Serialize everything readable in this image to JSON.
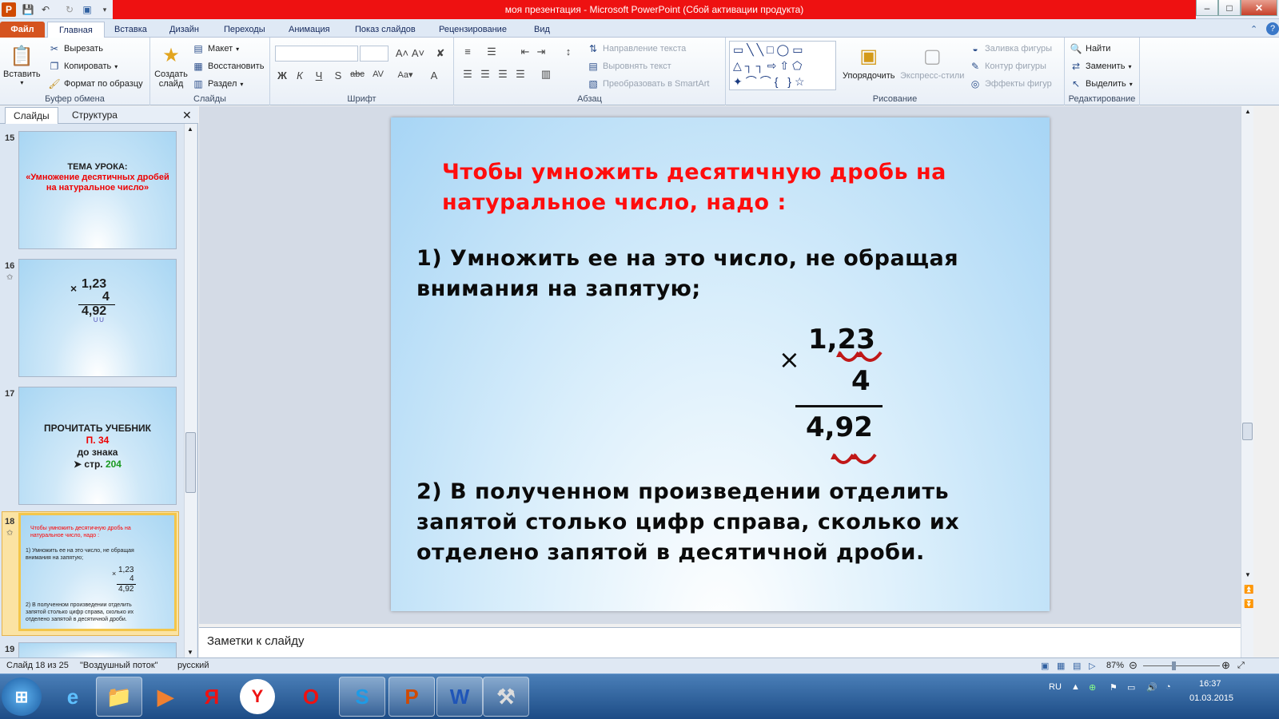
{
  "titlebar": {
    "title": "моя презентация  -  Microsoft PowerPoint (Сбой активации продукта)",
    "app_icon": "P"
  },
  "ribbon_tabs": [
    "Файл",
    "Главная",
    "Вставка",
    "Дизайн",
    "Переходы",
    "Анимация",
    "Показ слайдов",
    "Рецензирование",
    "Вид"
  ],
  "clipboard": {
    "paste": "Вставить",
    "cut": "Вырезать",
    "copy": "Копировать",
    "format_painter": "Формат по образцу",
    "label": "Буфер обмена"
  },
  "slides_group": {
    "new_slide": "Создать слайд",
    "layout": "Макет",
    "reset": "Восстановить",
    "section": "Раздел",
    "label": "Слайды"
  },
  "font_group": {
    "label": "Шрифт",
    "bold": "Ж",
    "italic": "К",
    "underline": "Ч",
    "shadow": "S",
    "strike": "abc"
  },
  "paragraph_group": {
    "text_direction": "Направление текста",
    "align_text": "Выровнять текст",
    "smartart": "Преобразовать в SmartArt",
    "label": "Абзац"
  },
  "drawing_group": {
    "arrange": "Упорядочить",
    "quick_styles": "Экспресс-стили",
    "shape_fill": "Заливка фигуры",
    "shape_outline": "Контур фигуры",
    "shape_effects": "Эффекты фигур",
    "label": "Рисование"
  },
  "editing_group": {
    "find": "Найти",
    "replace": "Заменить",
    "select": "Выделить",
    "label": "Редактирование"
  },
  "left_pane": {
    "tab_slides": "Слайды",
    "tab_outline": "Структура",
    "thumbs": [
      {
        "num": "15",
        "line1": "ТЕМА УРОКА:",
        "line2": "«Умножение десятичных дробей",
        "line3": "на натуральное число»"
      },
      {
        "num": "16",
        "a": "1,23",
        "b": "4",
        "c": "4,92"
      },
      {
        "num": "17",
        "line1": "ПРОЧИТАТЬ  УЧЕБНИК",
        "line2": "П. 34",
        "line3": "до знака",
        "line4": "стр.",
        "line5": "204"
      },
      {
        "num": "18",
        "line1": "Чтобы умножить десятичную дробь на",
        "line2": "натуральное число, надо :",
        "line3": "1) Умножить ее на это число, не обращая",
        "line4": "внимания на запятую;",
        "a": "1,23",
        "b": "4",
        "c": "4,92",
        "line5": "2) В полученном произведении отделить",
        "line6": "запятой столько цифр справа, сколько их",
        "line7": "отделено запятой в десятичной дроби."
      },
      {
        "num": "19"
      }
    ]
  },
  "slide": {
    "heading_line1": "Чтобы умножить десятичную дробь на",
    "heading_line2": "натуральное число, надо :",
    "step1_line1": "1) Умножить ее на это число, не обращая",
    "step1_line2": "внимания на запятую;",
    "mult_sign": "×",
    "factor1": "1,23",
    "factor2": "4",
    "product": "4,92",
    "step2_line1": "2) В полученном произведении отделить",
    "step2_line2": "запятой столько цифр справа, сколько их",
    "step2_line3": "отделено запятой в десятичной дроби."
  },
  "notes": {
    "placeholder": "Заметки к слайду"
  },
  "status": {
    "slide_info": "Слайд 18 из 25",
    "theme": "\"Воздушный поток\"",
    "language": "русский",
    "zoom": "87%"
  },
  "tray": {
    "lang": "RU",
    "time": "16:37",
    "date": "01.03.2015"
  }
}
